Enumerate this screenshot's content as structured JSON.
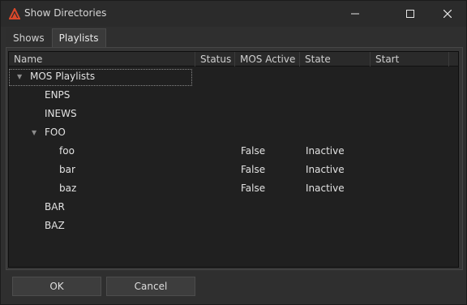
{
  "window": {
    "title": "Show Directories",
    "accent_color": "#d9482b"
  },
  "tabs": [
    {
      "label": "Shows",
      "active": false
    },
    {
      "label": "Playlists",
      "active": true
    }
  ],
  "tree": {
    "columns": [
      "Name",
      "Status",
      "MOS Active",
      "State",
      "Start"
    ],
    "rows": [
      {
        "name": "MOS Playlists",
        "expanded": true,
        "selected": true,
        "mos_active": "",
        "state": ""
      },
      {
        "name": "ENPS",
        "mos_active": "",
        "state": ""
      },
      {
        "name": "INEWS",
        "mos_active": "",
        "state": ""
      },
      {
        "name": "FOO",
        "expanded": true,
        "mos_active": "",
        "state": ""
      },
      {
        "name": "foo",
        "mos_active": "False",
        "state": "Inactive"
      },
      {
        "name": "bar",
        "mos_active": "False",
        "state": "Inactive"
      },
      {
        "name": "baz",
        "mos_active": "False",
        "state": "Inactive"
      },
      {
        "name": "BAR",
        "mos_active": "",
        "state": ""
      },
      {
        "name": "BAZ",
        "mos_active": "",
        "state": ""
      }
    ]
  },
  "buttons": {
    "ok_label": "OK",
    "cancel_label": "Cancel"
  }
}
